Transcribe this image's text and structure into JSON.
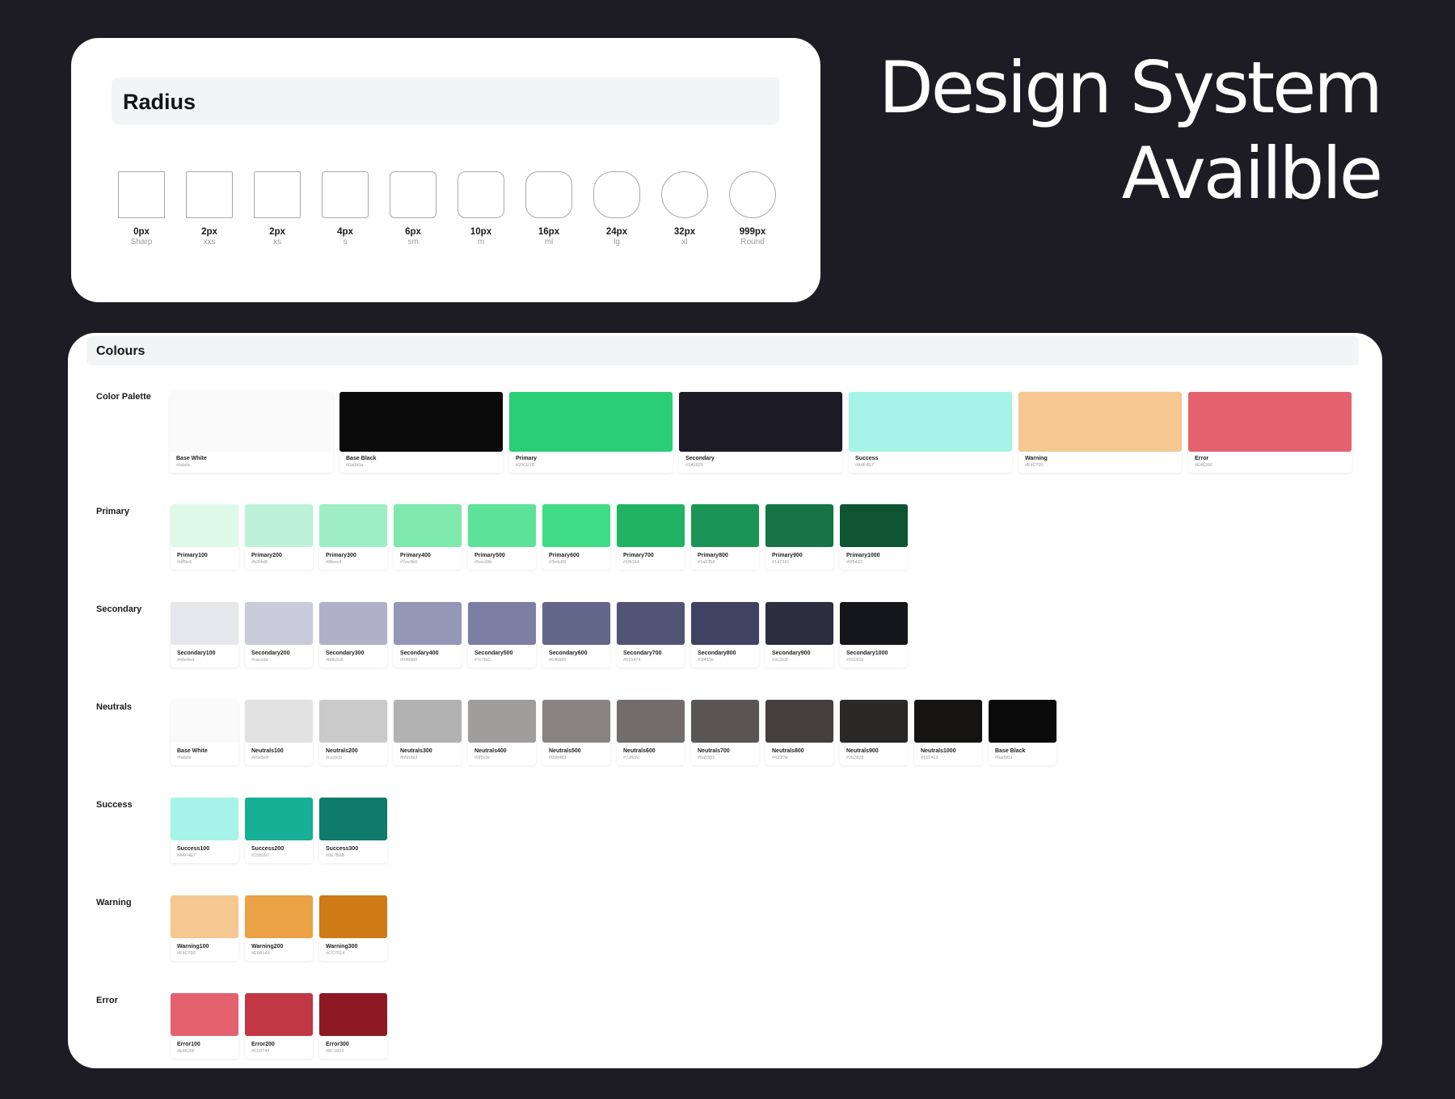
{
  "hero": {
    "line1": "Design System",
    "line2": "Availble"
  },
  "radius": {
    "title": "Radius",
    "items": [
      {
        "value": "0px",
        "name": "Sharp",
        "radius": 0
      },
      {
        "value": "2px",
        "name": "xxs",
        "radius": 2
      },
      {
        "value": "2px",
        "name": "xs",
        "radius": 2
      },
      {
        "value": "4px",
        "name": "s",
        "radius": 4
      },
      {
        "value": "6px",
        "name": "sm",
        "radius": 6
      },
      {
        "value": "10px",
        "name": "m",
        "radius": 10
      },
      {
        "value": "16px",
        "name": "ml",
        "radius": 16
      },
      {
        "value": "24px",
        "name": "lg",
        "radius": 24
      },
      {
        "value": "32px",
        "name": "xl",
        "radius": 32
      },
      {
        "value": "999px",
        "name": "Round",
        "radius": 999
      }
    ]
  },
  "colours": {
    "title": "Colours",
    "palette": {
      "label": "Color Palette",
      "items": [
        {
          "name": "Base White",
          "hex": "#fafafa",
          "color": "#fafafa"
        },
        {
          "name": "Base Black",
          "hex": "#0a0b0a",
          "color": "#0b0b0b"
        },
        {
          "name": "Primary",
          "hex": "#29CE76",
          "color": "#29ce76"
        },
        {
          "name": "Secondary",
          "hex": "#1A1825",
          "color": "#1c1b26"
        },
        {
          "name": "Success",
          "hex": "#A4F4E7",
          "color": "#a6f4e7"
        },
        {
          "name": "Warning",
          "hex": "#F4C790",
          "color": "#f4c890"
        },
        {
          "name": "Error",
          "hex": "#E4626F",
          "color": "#e4626f"
        }
      ]
    },
    "rows": [
      {
        "label": "Primary",
        "items": [
          {
            "name": "Primary100",
            "hex": "#dff9e6",
            "color": "#dff9e8"
          },
          {
            "name": "Primary200",
            "hex": "#b2f4d8",
            "color": "#bdf1d8"
          },
          {
            "name": "Primary300",
            "hex": "#9feec4",
            "color": "#9fefc5"
          },
          {
            "name": "Primary400",
            "hex": "#7ee9b0",
            "color": "#7ee8ad"
          },
          {
            "name": "Primary500",
            "hex": "#5ee29b",
            "color": "#5de299"
          },
          {
            "name": "Primary600",
            "hex": "#3edc89",
            "color": "#3fdb86"
          },
          {
            "name": "Primary700",
            "hex": "#1fb164",
            "color": "#21b264"
          },
          {
            "name": "Primary800",
            "hex": "#1a9358",
            "color": "#1b9556"
          },
          {
            "name": "Primary900",
            "hex": "#147341",
            "color": "#177445"
          },
          {
            "name": "Primary1000",
            "hex": "#0f5433",
            "color": "#0f5433"
          }
        ]
      },
      {
        "label": "Secondary",
        "items": [
          {
            "name": "Secondary100",
            "hex": "#e6e6ed",
            "color": "#e6e6ed"
          },
          {
            "name": "Secondary200",
            "hex": "#caccda",
            "color": "#cacbd9"
          },
          {
            "name": "Secondary300",
            "hex": "#b0b2c8",
            "color": "#b0b1c9"
          },
          {
            "name": "Secondary400",
            "hex": "#9499b5",
            "color": "#9498b6"
          },
          {
            "name": "Secondary500",
            "hex": "#7c7fa2",
            "color": "#7c7fa3"
          },
          {
            "name": "Secondary600",
            "hex": "#646886",
            "color": "#636789"
          },
          {
            "name": "Secondary700",
            "hex": "#515474",
            "color": "#515474"
          },
          {
            "name": "Secondary800",
            "hex": "#3f413e",
            "color": "#3f4260"
          },
          {
            "name": "Secondary900",
            "hex": "#2c2e3f",
            "color": "#2c2d3e"
          },
          {
            "name": "Secondary1000",
            "hex": "#15161b",
            "color": "#15161b"
          }
        ]
      },
      {
        "label": "Neutrals",
        "items": [
          {
            "name": "Base White",
            "hex": "#fafafa",
            "color": "#fafafa"
          },
          {
            "name": "Neutrals100",
            "hex": "#e5e5e5",
            "color": "#e2e2e2"
          },
          {
            "name": "Neutrals200",
            "hex": "#cccbcb",
            "color": "#cbcaca"
          },
          {
            "name": "Neutrals300",
            "hex": "#b5b3b3",
            "color": "#b3b2b2"
          },
          {
            "name": "Neutrals400",
            "hex": "#9f9c9c",
            "color": "#9f9c9c"
          },
          {
            "name": "Neutrals500",
            "hex": "#898483",
            "color": "#898484"
          },
          {
            "name": "Neutrals600",
            "hex": "#726c6c",
            "color": "#726d6c"
          },
          {
            "name": "Neutrals700",
            "hex": "#5a5555",
            "color": "#5a5555"
          },
          {
            "name": "Neutrals800",
            "hex": "#433f3e",
            "color": "#433f3e"
          },
          {
            "name": "Neutrals900",
            "hex": "#2b2828",
            "color": "#2b2828"
          },
          {
            "name": "Neutrals1000",
            "hex": "#151413",
            "color": "#151413"
          },
          {
            "name": "Base Black",
            "hex": "#0a0b0a",
            "color": "#0b0b0b"
          }
        ]
      },
      {
        "label": "Success",
        "items": [
          {
            "name": "Success100",
            "hex": "#A4F4E7",
            "color": "#a6f4e7"
          },
          {
            "name": "Success200",
            "hex": "#15B097",
            "color": "#16b097"
          },
          {
            "name": "Success300",
            "hex": "#0E7B6B",
            "color": "#0e7b6b"
          }
        ]
      },
      {
        "label": "Warning",
        "items": [
          {
            "name": "Warning100",
            "hex": "#F4C790",
            "color": "#f4c890"
          },
          {
            "name": "Warning200",
            "hex": "#E8A145",
            "color": "#eba145"
          },
          {
            "name": "Warning300",
            "hex": "#CC7914",
            "color": "#cd7a17"
          }
        ]
      },
      {
        "label": "Error",
        "items": [
          {
            "name": "Error100",
            "hex": "#E4626F",
            "color": "#e4626f"
          },
          {
            "name": "Error200",
            "hex": "#C03744",
            "color": "#c13744"
          },
          {
            "name": "Error300",
            "hex": "#8C1823",
            "color": "#8c1923"
          }
        ]
      }
    ]
  }
}
